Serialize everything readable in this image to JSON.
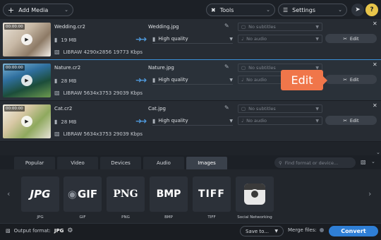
{
  "toolbar": {
    "add_media": "Add Media",
    "tools": "Tools",
    "settings": "Settings"
  },
  "files": [
    {
      "timecode": "00:00:00",
      "name": "Wedding.cr2",
      "size": "19 MB",
      "info": "LIBRAW 4290x2856 19773 Kbps",
      "output_name": "Wedding.jpg",
      "quality": "High quality",
      "subtitles": "No subtitles",
      "audio": "No audio",
      "edit_label": "Edit"
    },
    {
      "timecode": "00:00:00",
      "name": "Nature.cr2",
      "size": "28 MB",
      "info": "LIBRAW 5634x3753 29039 Kbps",
      "output_name": "Nature.jpg",
      "quality": "High quality",
      "subtitles": "No subtitles",
      "audio": "No audio",
      "edit_label": "Edit"
    },
    {
      "timecode": "00:00:00",
      "name": "Cat.cr2",
      "size": "28 MB",
      "info": "LIBRAW 5634x3753 29039 Kbps",
      "output_name": "Cat.jpg",
      "quality": "High quality",
      "subtitles": "No subtitles",
      "audio": "No audio",
      "edit_label": "Edit"
    }
  ],
  "tooltip": "Edit",
  "tabs": [
    "Popular",
    "Video",
    "Devices",
    "Audio",
    "Images"
  ],
  "active_tab": "Images",
  "search_placeholder": "Find format or device...",
  "formats": [
    {
      "logo": "JPG",
      "label": "JPG"
    },
    {
      "logo": "GIF",
      "label": "GIF"
    },
    {
      "logo": "PNG",
      "label": "PNG"
    },
    {
      "logo": "BMP",
      "label": "BMP"
    },
    {
      "logo": "TIFF",
      "label": "TIFF"
    },
    {
      "logo": "",
      "label": "Social Networking"
    }
  ],
  "bottom": {
    "output_format_label": "Output format:",
    "output_format_value": "JPG",
    "save_to": "Save to...",
    "merge_files": "Merge files:",
    "convert": "Convert"
  },
  "colors": {
    "accent": "#2f7fd6",
    "tooltip": "#f0764a",
    "selection": "#3a8fd6"
  }
}
